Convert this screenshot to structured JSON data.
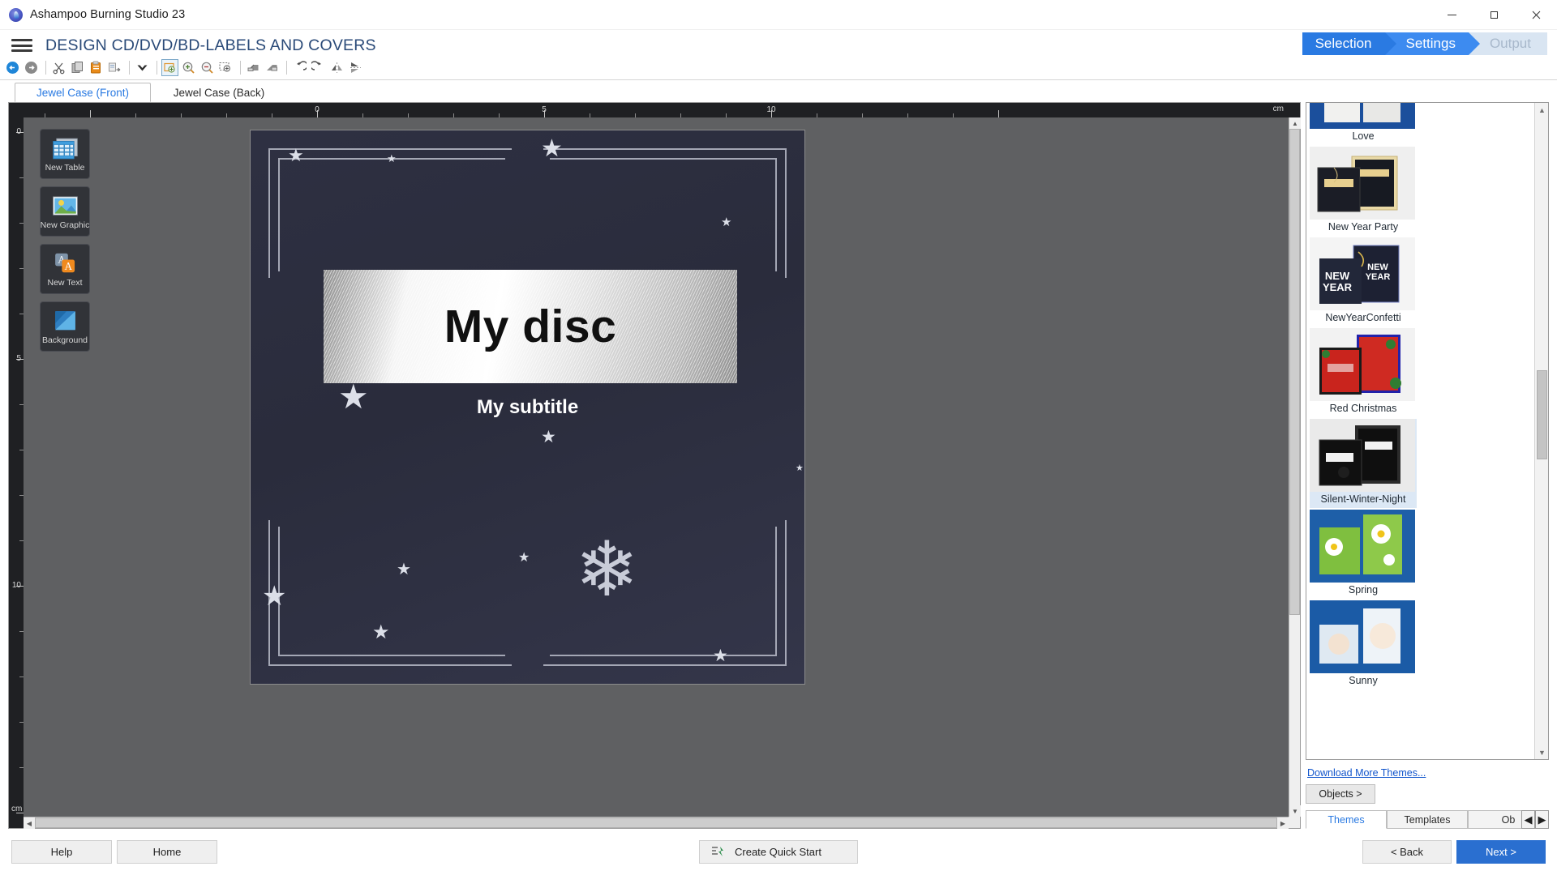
{
  "window": {
    "title": "Ashampoo Burning Studio 23",
    "app_icon": "flame-disc-icon",
    "controls": {
      "minimize": "minimize-icon",
      "maximize": "maximize-icon",
      "close": "close-icon"
    }
  },
  "header": {
    "menu_icon": "hamburger-menu-icon",
    "page_title": "DESIGN CD/DVD/BD-LABELS AND COVERS",
    "breadcrumb": [
      {
        "label": "Selection",
        "state": "done"
      },
      {
        "label": "Settings",
        "state": "current"
      },
      {
        "label": "Output",
        "state": "upcoming"
      }
    ]
  },
  "toolbar": {
    "items": [
      {
        "name": "back-icon",
        "title": "Back"
      },
      {
        "name": "forward-icon",
        "title": "Forward"
      },
      {
        "sep": true
      },
      {
        "name": "cut-icon",
        "title": "Cut"
      },
      {
        "name": "copy-icon",
        "title": "Copy"
      },
      {
        "name": "paste-icon",
        "title": "Paste"
      },
      {
        "name": "paste-special-icon",
        "title": "Paste Special"
      },
      {
        "sep": true
      },
      {
        "name": "delete-icon",
        "title": "Delete"
      },
      {
        "sep": true
      },
      {
        "name": "zoom-fit-icon",
        "title": "Zoom to fit"
      },
      {
        "name": "zoom-in-icon",
        "title": "Zoom in"
      },
      {
        "name": "zoom-out-icon",
        "title": "Zoom out"
      },
      {
        "name": "zoom-selection-icon",
        "title": "Zoom to selection"
      },
      {
        "sep": true
      },
      {
        "name": "bring-to-front-icon",
        "title": "Bring to front"
      },
      {
        "name": "send-to-back-icon",
        "title": "Send to back"
      },
      {
        "sep": true
      },
      {
        "name": "rotate-left-icon",
        "title": "Rotate left"
      },
      {
        "name": "rotate-right-icon",
        "title": "Rotate right"
      },
      {
        "name": "flip-horizontal-icon",
        "title": "Flip horizontally"
      },
      {
        "name": "flip-vertical-icon",
        "title": "Flip vertically"
      }
    ]
  },
  "tabs": [
    {
      "label": "Jewel Case (Front)",
      "active": true
    },
    {
      "label": "Jewel Case (Back)",
      "active": false
    }
  ],
  "editor": {
    "ruler_unit": "cm",
    "ruler_unit_left": "cm",
    "top_ticks": [
      {
        "value": "0",
        "cm": 0
      },
      {
        "value": "5",
        "cm": 5
      },
      {
        "value": "10",
        "cm": 10
      }
    ],
    "left_ticks": [
      {
        "value": "0",
        "cm": 0
      },
      {
        "value": "5",
        "cm": 5
      },
      {
        "value": "10",
        "cm": 10
      }
    ],
    "palette": [
      {
        "label": "New Table",
        "icon": "table-icon"
      },
      {
        "label": "New Graphic",
        "icon": "image-icon"
      },
      {
        "label": "New Text",
        "icon": "text-icon"
      },
      {
        "label": "Background",
        "icon": "background-icon"
      }
    ],
    "design": {
      "title": "My disc",
      "subtitle": "My subtitle",
      "background_color": "#2e3042",
      "plate_style": "brushed-metal",
      "decorations": "stars-and-snowflake"
    }
  },
  "themes_panel": {
    "items": [
      {
        "name": "Love",
        "selected": false
      },
      {
        "name": "New Year Party",
        "selected": false
      },
      {
        "name": "NewYearConfetti",
        "selected": false
      },
      {
        "name": "Red Christmas",
        "selected": false
      },
      {
        "name": "Silent-Winter-Night",
        "selected": true
      },
      {
        "name": "Spring",
        "selected": false
      },
      {
        "name": "Sunny",
        "selected": false
      }
    ],
    "download_link": "Download More Themes...",
    "objects_button": "Objects >",
    "tabs": [
      {
        "label": "Themes",
        "active": true
      },
      {
        "label": "Templates",
        "active": false
      },
      {
        "label": "Ob",
        "active": false
      }
    ],
    "nav_prev": "◀",
    "nav_next": "▶"
  },
  "bottom_bar": {
    "help": "Help",
    "home": "Home",
    "quick_start": "Create Quick Start",
    "quick_start_icon": "quick-start-icon",
    "back": "< Back",
    "next": "Next >"
  },
  "colors": {
    "accent_blue": "#2a7ae2",
    "primary_button": "#2a6fd0",
    "breadcrumb_done": "#2a7ae2",
    "breadcrumb_current": "#3d8bf0",
    "breadcrumb_upcoming": "#d9e5f2",
    "canvas_bg": "#5f6062",
    "design_bg": "#2e3042"
  }
}
